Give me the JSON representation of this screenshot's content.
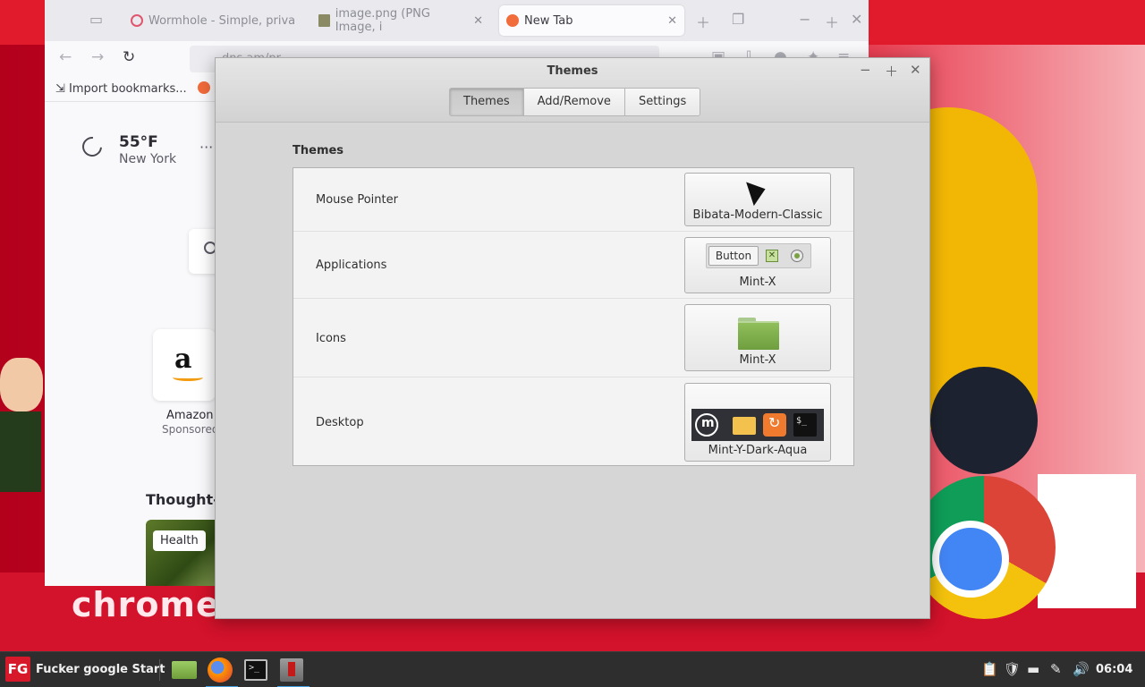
{
  "wallpaper": {
    "bottom_text": "chrome s"
  },
  "browser": {
    "tabs": [
      {
        "label": "Wormhole - Simple, priva",
        "active": false
      },
      {
        "label": "image.png (PNG Image, i",
        "active": false
      },
      {
        "label": "New Tab",
        "active": true
      }
    ],
    "url_text": "dns.am/pr",
    "bookmark": "Import bookmarks...",
    "weather": {
      "temp": "55°F",
      "city": "New York"
    },
    "shortcut": {
      "name": "Amazon",
      "badge": "Sponsored"
    },
    "section_title": "Thought-p",
    "story_tag": "Health"
  },
  "dialog": {
    "title": "Themes",
    "tabs": [
      {
        "label": "Themes",
        "active": true
      },
      {
        "label": "Add/Remove",
        "active": false
      },
      {
        "label": "Settings",
        "active": false
      }
    ],
    "section_title": "Themes",
    "rows": [
      {
        "label": "Mouse Pointer",
        "value": "Bibata-Modern-Classic"
      },
      {
        "label": "Applications",
        "value": "Mint-X",
        "preview_button": "Button"
      },
      {
        "label": "Icons",
        "value": "Mint-X"
      },
      {
        "label": "Desktop",
        "value": "Mint-Y-Dark-Aqua"
      }
    ]
  },
  "taskbar": {
    "start_logo": "FG",
    "start_label": "Fucker google Start",
    "clock": "06:04"
  },
  "colors": {
    "accent_red": "#d7182a",
    "taskbar_bg": "#2e2e2e",
    "dialog_bg": "#d6d6d6"
  }
}
